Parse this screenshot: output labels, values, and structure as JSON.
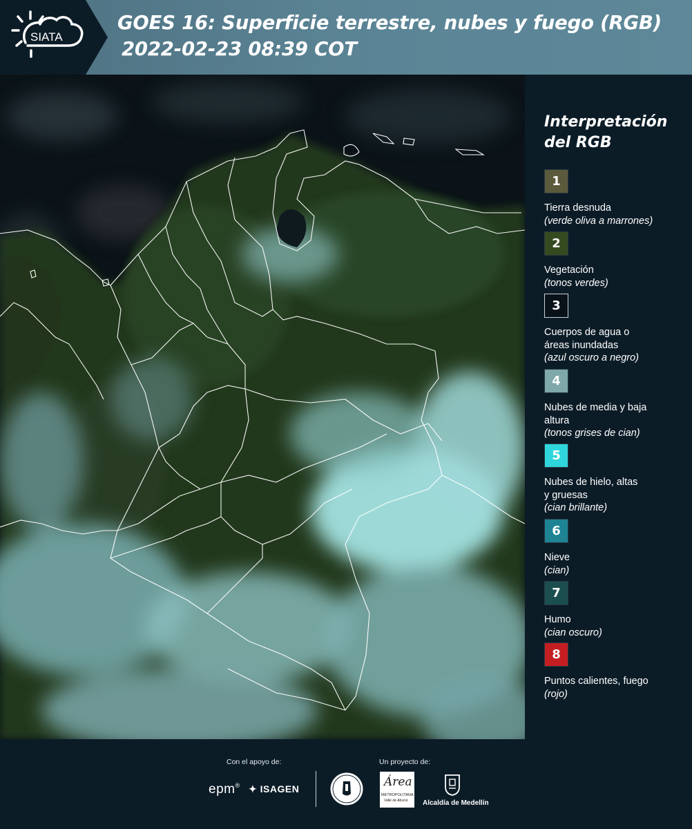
{
  "header": {
    "logo_text": "SIATA",
    "title_line1": "GOES 16: Superficie terrestre, nubes y fuego (RGB)",
    "title_line2": "2022-02-23 08:39 COT"
  },
  "legend": {
    "title_line1": "Interpretación",
    "title_line2": "del RGB",
    "items": [
      {
        "number": "1",
        "color": "#5c5a3c",
        "label": "Tierra desnuda",
        "note": "(verde oliva a marrones)"
      },
      {
        "number": "2",
        "color": "#344a1f",
        "label": "Vegetación",
        "note": "(tonos verdes)"
      },
      {
        "number": "3",
        "color": "#0a1219",
        "label": "Cuerpos de agua o áreas inundadas",
        "note": "(azul oscuro a negro)"
      },
      {
        "number": "4",
        "color": "#7fa8aa",
        "label": "Nubes de media y baja altura",
        "note": "(tonos grises de cian)"
      },
      {
        "number": "5",
        "color": "#2fd7dc",
        "label": "Nubes de hielo, altas y gruesas",
        "note": "(cian brillante)"
      },
      {
        "number": "6",
        "color": "#1e8494",
        "label": "Nieve",
        "note": "(cian)"
      },
      {
        "number": "7",
        "color": "#1b4f4f",
        "label": "Humo",
        "note": "(cian oscuro)"
      },
      {
        "number": "8",
        "color": "#c41e22",
        "label": "Puntos calientes, fuego",
        "note": "(rojo)"
      }
    ]
  },
  "footer": {
    "support_label": "Con el apoyo de:",
    "project_label": "Un proyecto de:",
    "sponsors": [
      "epm",
      "ISAGEN"
    ],
    "partners": [
      "Área Metropolitana",
      "Alcaldía de Medellín"
    ],
    "partner_small": "METROPOLITANA",
    "partner_small2": "Valle de Aburrá"
  }
}
